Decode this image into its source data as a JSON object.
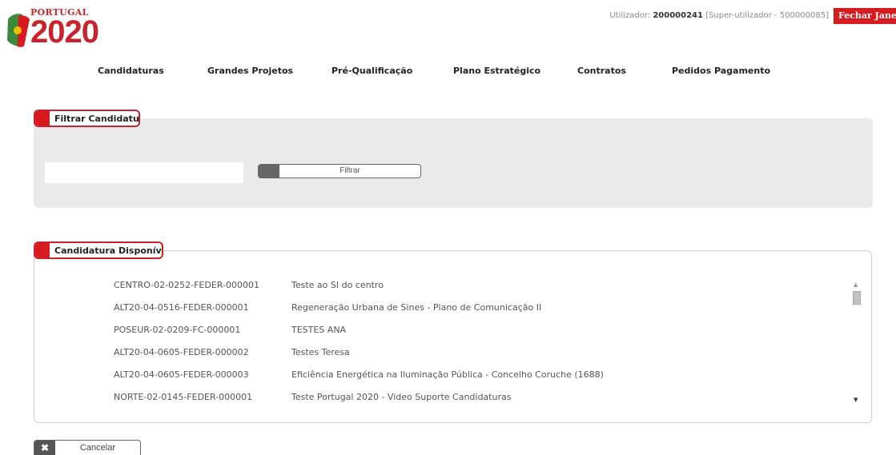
{
  "header": {
    "logo_small": "PORTUGAL",
    "logo_big": "2020",
    "user_label": "Utilizador: ",
    "user_id": "200000241",
    "user_role": " [Super-utilizador - 500000085]",
    "close_label": "Fechar Janela"
  },
  "nav": {
    "items": [
      "Candidaturas",
      "Grandes Projetos",
      "Pré-Qualificação",
      "Plano Estratégico",
      "Contratos",
      "Pedidos Pagamento"
    ]
  },
  "filter": {
    "title": "Filtrar Candidatura",
    "input_value": "",
    "button_label": "Filtrar"
  },
  "list": {
    "title": "Candidatura Disponíveis",
    "rows": [
      {
        "code": "CENTRO-02-0252-FEDER-000001",
        "desc": "Teste ao SI do centro"
      },
      {
        "code": "ALT20-04-0516-FEDER-000001",
        "desc": "Regeneração Urbana de Sines - Plano de Comunicação II"
      },
      {
        "code": "POSEUR-02-0209-FC-000001",
        "desc": "TESTES ANA"
      },
      {
        "code": "ALT20-04-0605-FEDER-000002",
        "desc": "Testes Teresa"
      },
      {
        "code": "ALT20-04-0605-FEDER-000003",
        "desc": "Eficiência Energética na Iluminação Pública - Concelho Coruche (1688)"
      },
      {
        "code": "NORTE-02-0145-FEDER-000001",
        "desc": "Teste Portugal 2020 - Video Suporte Candidaturas"
      }
    ]
  },
  "actions": {
    "cancel_label": "Cancelar"
  },
  "colors": {
    "brand_red": "#d71920",
    "logo_green": "#3a8a3c"
  }
}
